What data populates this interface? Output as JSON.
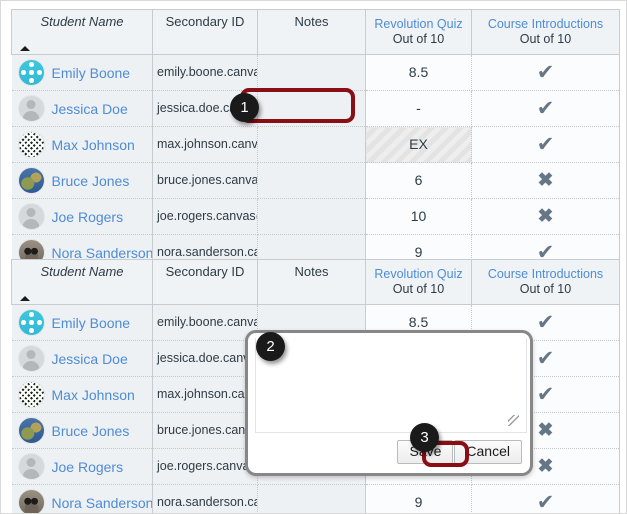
{
  "table": {
    "columns": [
      {
        "id": "student_name",
        "label": "Student Name",
        "style": "italic"
      },
      {
        "id": "secondary_id",
        "label": "Secondary ID",
        "style": "bold"
      },
      {
        "id": "notes",
        "label": "Notes",
        "style": "bold"
      },
      {
        "id": "assignment_1",
        "label": "Revolution Quiz",
        "points": "Out of 10"
      },
      {
        "id": "assignment_2",
        "label": "Course Introductions",
        "points": "Out of 10"
      }
    ],
    "sort_indicator": "ascending-arrow",
    "rows": [
      {
        "name": "Emily Boone",
        "secondary_id": "emily.boone.canvas@",
        "notes": "",
        "assignment_1": "8.5",
        "assignment_2": "check",
        "excused_1": false,
        "avatar": "teal"
      },
      {
        "name": "Jessica Doe",
        "secondary_id": "jessica.doe.canvas@",
        "notes": "",
        "assignment_1": "-",
        "assignment_2": "check",
        "excused_1": false,
        "avatar": "generic"
      },
      {
        "name": "Max Johnson",
        "secondary_id": "max.johnson.canvas@",
        "notes": "",
        "assignment_1": "EX",
        "assignment_2": "check",
        "excused_1": true,
        "avatar": "dark"
      },
      {
        "name": "Bruce Jones",
        "secondary_id": "bruce.jones.canvas@",
        "notes": "",
        "assignment_1": "6",
        "assignment_2": "cross",
        "excused_1": false,
        "avatar": "earth"
      },
      {
        "name": "Joe Rogers",
        "secondary_id": "joe.rogers.canvas@g",
        "notes": "",
        "assignment_1": "10",
        "assignment_2": "cross",
        "excused_1": false,
        "avatar": "generic"
      },
      {
        "name": "Nora Sanderson",
        "secondary_id": "nora.sanderson.canv",
        "notes": "",
        "assignment_1": "9",
        "assignment_2": "check",
        "excused_1": false,
        "avatar": "animal"
      }
    ]
  },
  "notes_popup": {
    "textarea_value": "",
    "save_label": "Save",
    "cancel_label": "Cancel"
  },
  "annotations": [
    {
      "number": "1",
      "target": "empty-notes-cell"
    },
    {
      "number": "2",
      "target": "notes-textarea"
    },
    {
      "number": "3",
      "target": "save-button"
    }
  ],
  "colors": {
    "link": "#4e8cd4",
    "highlight": "#8a0f14",
    "header_bg": "#eff3f6",
    "mark": "#657786"
  }
}
